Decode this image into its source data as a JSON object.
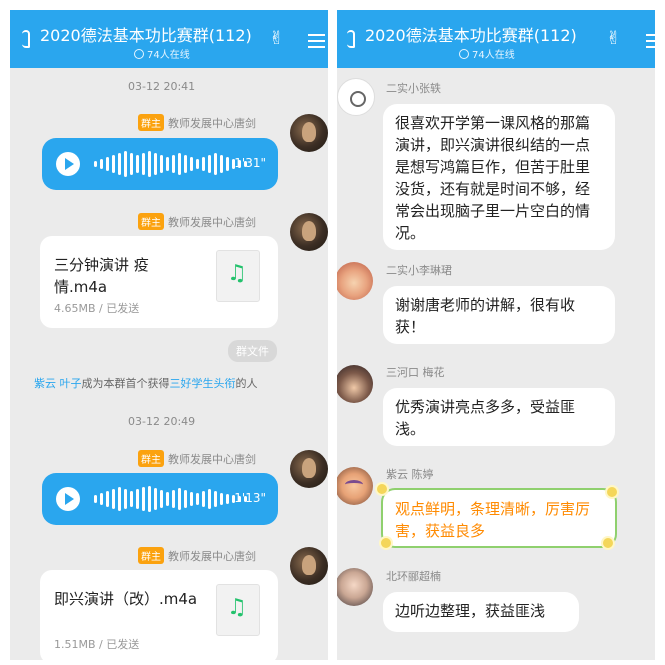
{
  "group": {
    "title": "2020德法基本功比赛群(112)",
    "online": "74人在线"
  },
  "left": {
    "ts1": "03-12 20:41",
    "ts2": "03-12 20:49",
    "owner_badge": "群主",
    "owner_name": "教师发展中心唐剑",
    "voice1_duration": "1'31\"",
    "voice2_duration": "1'13\"",
    "file1": {
      "name": "三分钟演讲 疫情.m4a",
      "meta": "4.65MB / 已发送"
    },
    "file2": {
      "name": "即兴演讲（改）.m4a",
      "meta": "1.51MB / 已发送"
    },
    "file_tag": "群文件",
    "sys": {
      "user": "紫云 叶子",
      "mid": "成为本群首个获得",
      "title": "三好学生头衔",
      "end": "的人"
    }
  },
  "right": {
    "messages": [
      {
        "sender": "二实小张轶",
        "text": "很喜欢开学第一课风格的那篇演讲，即兴演讲很纠结的一点是想写鸿篇巨作，但苦于肚里没货，还有就是时间不够，经常会出现脑子里一片空白的情况。"
      },
      {
        "sender": "二实小李琳珺",
        "text": "谢谢唐老师的讲解，很有收获！"
      },
      {
        "sender": "三河口 梅花",
        "text": "优秀演讲亮点多多，受益匪浅。"
      },
      {
        "sender": "紫云 陈婷",
        "text": "观点鲜明，条理清晰，厉害厉害，获益良多"
      },
      {
        "sender": "北环郦超楠",
        "text": "边听边整理，获益匪浅"
      }
    ]
  },
  "icons": {
    "ear": "ear-icon",
    "hand": "hand-icon",
    "menu": "menu-icon",
    "back": "back-arrow-icon",
    "play": "play-icon",
    "music": "music-file-icon"
  },
  "colors": {
    "header": "#2aa6ee",
    "voice_bubble": "#2aa6ee",
    "owner_badge": "#fba20f",
    "link": "#2aa6ee",
    "fancy_text": "#ff8a00"
  }
}
